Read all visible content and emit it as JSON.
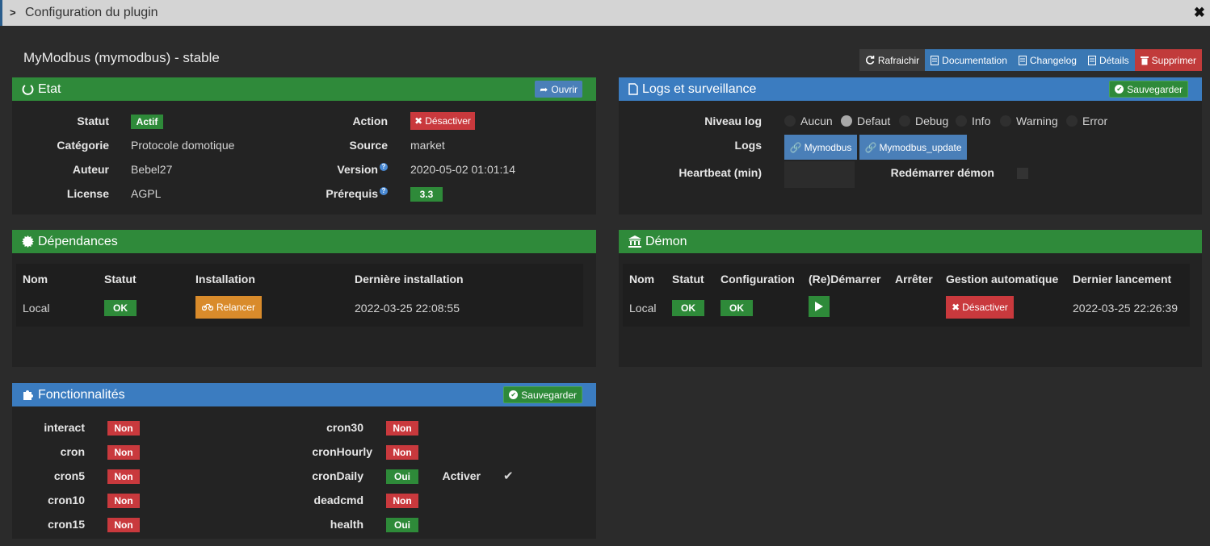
{
  "window": {
    "title": "Configuration du plugin",
    "close": "✖"
  },
  "plugin_name": "MyModbus (mymodbus) - stable",
  "toolbar": {
    "refresh": "Rafraichir",
    "documentation": "Documentation",
    "changelog": "Changelog",
    "details": "Détails",
    "delete": "Supprimer"
  },
  "etat": {
    "title": "Etat",
    "open_btn": "Ouvrir",
    "statut_label": "Statut",
    "statut_value": "Actif",
    "categorie_label": "Catégorie",
    "categorie_value": "Protocole domotique",
    "auteur_label": "Auteur",
    "auteur_value": "Bebel27",
    "license_label": "License",
    "license_value": "AGPL",
    "action_label": "Action",
    "action_btn": "Désactiver",
    "source_label": "Source",
    "source_value": "market",
    "version_label": "Version",
    "version_value": "2020-05-02 01:01:14",
    "prereq_label": "Prérequis",
    "prereq_value": "3.3",
    "help_mark": "?"
  },
  "logs": {
    "title": "Logs et surveillance",
    "save_btn": "Sauvegarder",
    "level_label": "Niveau log",
    "levels": [
      "Aucun",
      "Defaut",
      "Debug",
      "Info",
      "Warning",
      "Error"
    ],
    "selected_level": "Defaut",
    "logs_label": "Logs",
    "log_buttons": [
      "Mymodbus",
      "Mymodbus_update"
    ],
    "heartbeat_label": "Heartbeat (min)",
    "heartbeat_value": "",
    "restart_label": "Redémarrer démon"
  },
  "dependances": {
    "title": "Dépendances",
    "headers": [
      "Nom",
      "Statut",
      "Installation",
      "Dernière installation"
    ],
    "row": {
      "nom": "Local",
      "statut": "OK",
      "installation": "Relancer",
      "derniere": "2022-03-25 22:08:55"
    }
  },
  "demon": {
    "title": "Démon",
    "headers": [
      "Nom",
      "Statut",
      "Configuration",
      "(Re)Démarrer",
      "Arrêter",
      "Gestion automatique",
      "Dernier lancement"
    ],
    "row": {
      "nom": "Local",
      "statut": "OK",
      "configuration": "OK",
      "gestion": "Désactiver",
      "dernier": "2022-03-25 22:26:39"
    }
  },
  "fonctionnalites": {
    "title": "Fonctionnalités",
    "save_btn": "Sauvegarder",
    "left": [
      {
        "name": "interact",
        "value": "Non"
      },
      {
        "name": "cron",
        "value": "Non"
      },
      {
        "name": "cron5",
        "value": "Non"
      },
      {
        "name": "cron10",
        "value": "Non"
      },
      {
        "name": "cron15",
        "value": "Non"
      }
    ],
    "right": [
      {
        "name": "cron30",
        "value": "Non"
      },
      {
        "name": "cronHourly",
        "value": "Non"
      },
      {
        "name": "cronDaily",
        "value": "Oui"
      },
      {
        "name": "deadcmd",
        "value": "Non"
      },
      {
        "name": "health",
        "value": "Oui"
      }
    ],
    "activer_label": "Activer",
    "activer_check": "✔"
  },
  "colors": {
    "green": "#2f8a3a",
    "blue": "#3b7cc0",
    "red": "#c9393d",
    "orange": "#d98b2b"
  }
}
